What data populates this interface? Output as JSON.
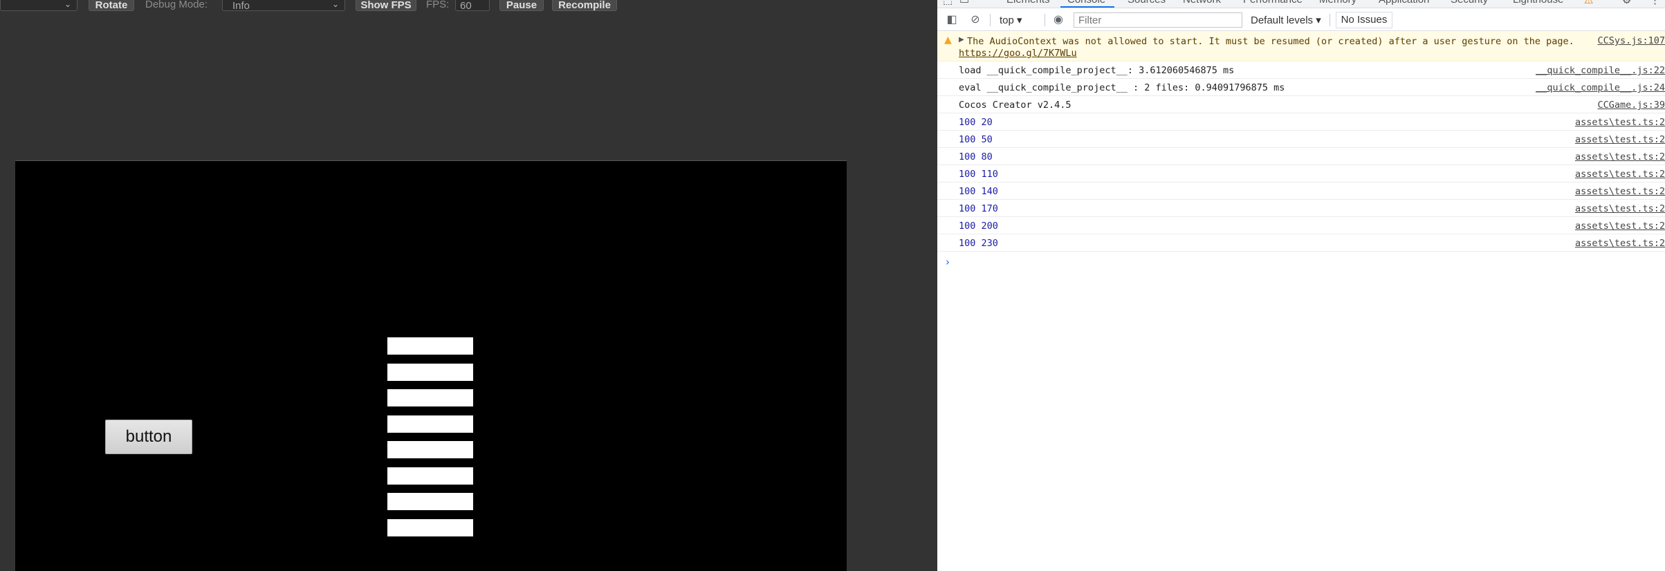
{
  "toolbar": {
    "rotate_label": "Rotate",
    "debug_mode_label": "Debug Mode:",
    "debug_mode_value": "Info",
    "show_fps_label": "Show FPS",
    "fps_label": "FPS:",
    "fps_value": "60",
    "pause_label": "Pause",
    "recompile_label": "Recompile"
  },
  "game": {
    "button_label": "button",
    "bar_count": 8
  },
  "devtools": {
    "tabs": [
      "Elements",
      "Console",
      "Sources",
      "Network",
      "Performance",
      "Memory",
      "Application",
      "Security",
      "Lighthouse"
    ],
    "active_tab": "Console",
    "context": "top",
    "filter_placeholder": "Filter",
    "levels": "Default levels",
    "issues": "No Issues"
  },
  "console": {
    "warning": {
      "text": "The AudioContext was not allowed to start. It must be resumed (or created) after a user gesture on the page.",
      "link": "https://goo.gl/7K7WLu",
      "source": "CCSys.js:107"
    },
    "messages": [
      {
        "text": "load __quick_compile_project__: 3.612060546875 ms",
        "source": "__quick_compile__.js:22",
        "numeric": false
      },
      {
        "text": "eval __quick_compile_project__ : 2 files: 0.94091796875 ms",
        "source": "__quick_compile__.js:24",
        "numeric": false
      },
      {
        "text": "Cocos Creator v2.4.5",
        "source": "CCGame.js:39",
        "numeric": false
      },
      {
        "text": "100 20",
        "source": "assets\\test.ts:2",
        "numeric": true
      },
      {
        "text": "100 50",
        "source": "assets\\test.ts:2",
        "numeric": true
      },
      {
        "text": "100 80",
        "source": "assets\\test.ts:2",
        "numeric": true
      },
      {
        "text": "100 110",
        "source": "assets\\test.ts:2",
        "numeric": true
      },
      {
        "text": "100 140",
        "source": "assets\\test.ts:2",
        "numeric": true
      },
      {
        "text": "100 170",
        "source": "assets\\test.ts:2",
        "numeric": true
      },
      {
        "text": "100 200",
        "source": "assets\\test.ts:2",
        "numeric": true
      },
      {
        "text": "100 230",
        "source": "assets\\test.ts:2",
        "numeric": true
      }
    ],
    "prompt_symbol": "›"
  }
}
